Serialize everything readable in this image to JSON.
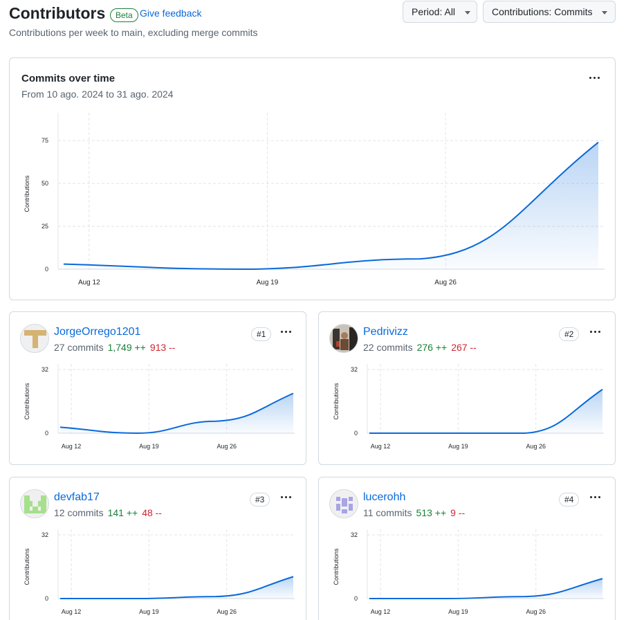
{
  "header": {
    "title": "Contributors",
    "beta_badge": "Beta",
    "feedback_link": "Give feedback",
    "subtitle": "Contributions per week to main, excluding merge commits",
    "period_label": "Period:",
    "period_value": "All",
    "contrib_label": "Contributions:",
    "contrib_value": "Commits"
  },
  "main_chart": {
    "title": "Commits over time",
    "subtitle": "From 10 ago. 2024 to 31 ago. 2024"
  },
  "chart_data": [
    {
      "type": "area",
      "title": "Commits over time",
      "ylabel": "Contributions",
      "xlabel": "",
      "x_ticks": [
        "Aug 12",
        "Aug 19",
        "Aug 26"
      ],
      "y_ticks": [
        0,
        25,
        50,
        75
      ],
      "ylim": [
        0,
        88
      ],
      "x": [
        "Aug 11",
        "Aug 18",
        "Aug 25",
        "Sep 1"
      ],
      "values": [
        3,
        0,
        6,
        74
      ],
      "color": "#0969da",
      "grid": true
    },
    {
      "type": "area",
      "title": "JorgeOrrego1201",
      "ylabel": "Contributions",
      "x_ticks": [
        "Aug 12",
        "Aug 19",
        "Aug 26"
      ],
      "y_ticks": [
        0,
        32
      ],
      "ylim": [
        0,
        32
      ],
      "x": [
        "Aug 11",
        "Aug 18",
        "Aug 25",
        "Sep 1"
      ],
      "values": [
        3,
        0,
        6,
        20
      ],
      "color": "#0969da",
      "grid": true
    },
    {
      "type": "area",
      "title": "Pedrivizz",
      "ylabel": "Contributions",
      "x_ticks": [
        "Aug 12",
        "Aug 19",
        "Aug 26"
      ],
      "y_ticks": [
        0,
        32
      ],
      "ylim": [
        0,
        32
      ],
      "x": [
        "Aug 11",
        "Aug 18",
        "Aug 25",
        "Sep 1"
      ],
      "values": [
        0,
        0,
        0,
        22
      ],
      "color": "#0969da",
      "grid": true
    },
    {
      "type": "area",
      "title": "devfab17",
      "ylabel": "Contributions",
      "x_ticks": [
        "Aug 12",
        "Aug 19",
        "Aug 26"
      ],
      "y_ticks": [
        0,
        32
      ],
      "ylim": [
        0,
        32
      ],
      "x": [
        "Aug 11",
        "Aug 18",
        "Aug 25",
        "Sep 1"
      ],
      "values": [
        0,
        0,
        1,
        11
      ],
      "color": "#0969da",
      "grid": true
    },
    {
      "type": "area",
      "title": "lucerohh",
      "ylabel": "Contributions",
      "x_ticks": [
        "Aug 12",
        "Aug 19",
        "Aug 26"
      ],
      "y_ticks": [
        0,
        32
      ],
      "ylim": [
        0,
        32
      ],
      "x": [
        "Aug 11",
        "Aug 18",
        "Aug 25",
        "Sep 1"
      ],
      "values": [
        0,
        0,
        1,
        10
      ],
      "color": "#0969da",
      "grid": true
    }
  ],
  "contributors": [
    {
      "name": "JorgeOrrego1201",
      "commits": "27 commits",
      "additions": "1,749 ++",
      "deletions": "913 --",
      "rank": "#1",
      "avatar_icon": "identicon-tan"
    },
    {
      "name": "Pedrivizz",
      "commits": "22 commits",
      "additions": "276 ++",
      "deletions": "267 --",
      "rank": "#2",
      "avatar_icon": "photo-avatar"
    },
    {
      "name": "devfab17",
      "commits": "12 commits",
      "additions": "141 ++",
      "deletions": "48 --",
      "rank": "#3",
      "avatar_icon": "identicon-green"
    },
    {
      "name": "lucerohh",
      "commits": "11 commits",
      "additions": "513 ++",
      "deletions": "9 --",
      "rank": "#4",
      "avatar_icon": "identicon-purple"
    }
  ]
}
